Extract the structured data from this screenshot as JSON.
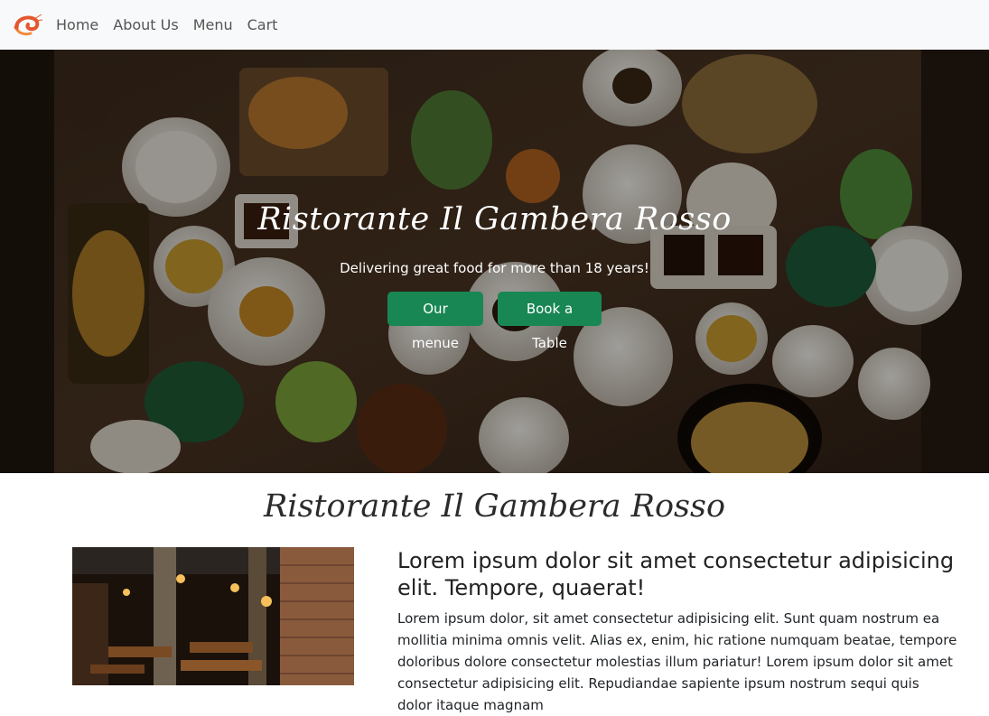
{
  "navbar": {
    "logo_icon": "shrimp-icon",
    "links": [
      "Home",
      "About Us",
      "Menu",
      "Cart"
    ]
  },
  "hero": {
    "title": "Ristorante Il Gambera Rosso",
    "subtitle": "Delivering great food for more than 18 years!",
    "buttons": {
      "menu": "Our menue",
      "book": "Book a Table"
    },
    "button_color": "#198754"
  },
  "about": {
    "title": "Ristorante Il Gambera Rosso",
    "heading": "Lorem ipsum dolor sit amet consectetur adipisicing elit. Tempore, quaerat!",
    "text": "Lorem ipsum dolor, sit amet consectetur adipisicing elit. Sunt quam nostrum ea mollitia minima omnis velit. Alias ex, enim, hic ratione numquam beatae, tempore doloribus dolore consectetur molestias illum pariatur! Lorem ipsum dolor sit amet consectetur adipisicing elit. Repudiandae sapiente ipsum nostrum sequi quis dolor itaque magnam",
    "image_icon": "restaurant-interior-image"
  }
}
